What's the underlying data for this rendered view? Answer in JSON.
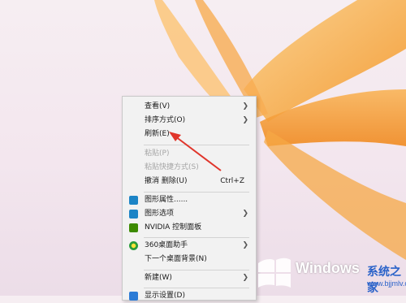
{
  "menu": {
    "items": [
      {
        "label": "查看(V)"
      },
      {
        "label": "排序方式(O)"
      },
      {
        "label": "刷新(E)"
      },
      {
        "label": "粘贴(P)"
      },
      {
        "label": "粘贴快捷方式(S)"
      },
      {
        "label": "撤消 删除(U)",
        "shortcut": "Ctrl+Z"
      },
      {
        "label": "图形属性......"
      },
      {
        "label": "图形选项"
      },
      {
        "label": "NVIDIA 控制面板"
      },
      {
        "label": "360桌面助手"
      },
      {
        "label": "下一个桌面背景(N)"
      },
      {
        "label": "新建(W)"
      },
      {
        "label": "显示设置(D)"
      }
    ]
  },
  "watermark": {
    "brand": "Windows",
    "site_name": "系统之家",
    "url": "www.bjjmlv.com"
  },
  "colors": {
    "annotation_arrow": "#e0352b",
    "petal": "#f7a13a"
  }
}
